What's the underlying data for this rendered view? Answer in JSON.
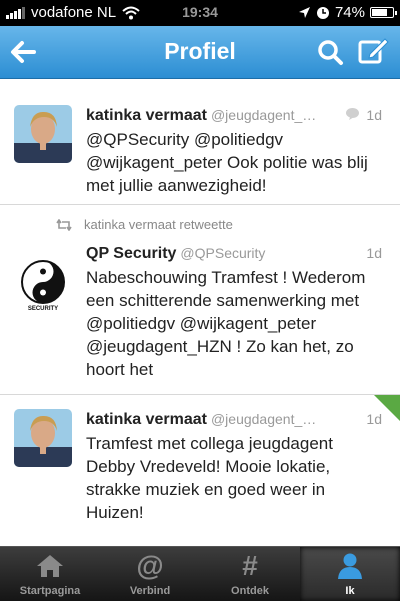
{
  "status_bar": {
    "carrier": "vodafone NL",
    "time": "19:34",
    "battery": "74%",
    "battery_level": 0.74
  },
  "nav": {
    "title": "Profiel",
    "icons": {
      "back": "arrow-left",
      "search": "search",
      "compose": "compose"
    }
  },
  "tweets": [
    {
      "name": "katinka vermaat",
      "handle": "@jeugdagent_…",
      "time": "1d",
      "text": "@QPSecurity @politiedgv @wijkagent_peter Ook politie was blij met jullie aanwezigheid!",
      "is_reply": true
    },
    {
      "retweeted_by": "katinka vermaat retweette",
      "name": "QP Security",
      "handle": "@QPSecurity",
      "time": "1d",
      "text": "Nabeschouwing Tramfest ! Wederom een schitterende samenwerking met @politiedgv @wijkagent_peter @jeugdagent_HZN  ! Zo kan het, zo hoort het",
      "avatar_text": "SECURITY"
    },
    {
      "name": "katinka vermaat",
      "handle": "@jeugdagent_…",
      "time": "1d",
      "text": "Tramfest met collega jeugdagent Debby Vredeveld! Mooie lokatie, strakke muziek en goed weer in Huizen!",
      "favorited": true
    }
  ],
  "tabs": [
    {
      "label": "Startpagina",
      "icon": "home",
      "active": false
    },
    {
      "label": "Verbind",
      "icon": "@",
      "active": false
    },
    {
      "label": "Ontdek",
      "icon": "#",
      "active": false
    },
    {
      "label": "Ik",
      "icon": "person",
      "active": true
    }
  ],
  "colors": {
    "nav_gradient_top": "#67b6ea",
    "nav_gradient_bottom": "#2c8ed3",
    "favorite_corner": "#5aa943",
    "active_tab_icon": "#3a9be0"
  }
}
